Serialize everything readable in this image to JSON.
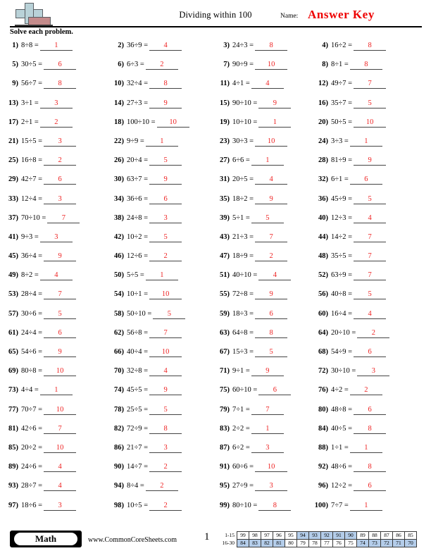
{
  "header": {
    "title": "Dividing within 100",
    "name_label": "Name:",
    "answer_key": "Answer Key",
    "instructions": "Solve each problem.",
    "logo_name": "commoncoresheets-logo"
  },
  "problems": [
    {
      "num": "1)",
      "expr": "8÷8 =",
      "answer": "1"
    },
    {
      "num": "2)",
      "expr": "36÷9 =",
      "answer": "4"
    },
    {
      "num": "3)",
      "expr": "24÷3 =",
      "answer": "8"
    },
    {
      "num": "4)",
      "expr": "16÷2 =",
      "answer": "8"
    },
    {
      "num": "5)",
      "expr": "30÷5 =",
      "answer": "6"
    },
    {
      "num": "6)",
      "expr": "6÷3 =",
      "answer": "2"
    },
    {
      "num": "7)",
      "expr": "90÷9 =",
      "answer": "10"
    },
    {
      "num": "8)",
      "expr": "8÷1 =",
      "answer": "8"
    },
    {
      "num": "9)",
      "expr": "56÷7 =",
      "answer": "8"
    },
    {
      "num": "10)",
      "expr": "32÷4 =",
      "answer": "8"
    },
    {
      "num": "11)",
      "expr": "4÷1 =",
      "answer": "4"
    },
    {
      "num": "12)",
      "expr": "49÷7 =",
      "answer": "7"
    },
    {
      "num": "13)",
      "expr": "3÷1 =",
      "answer": "3"
    },
    {
      "num": "14)",
      "expr": "27÷3 =",
      "answer": "9"
    },
    {
      "num": "15)",
      "expr": "90÷10 =",
      "answer": "9"
    },
    {
      "num": "16)",
      "expr": "35÷7 =",
      "answer": "5"
    },
    {
      "num": "17)",
      "expr": "2÷1 =",
      "answer": "2"
    },
    {
      "num": "18)",
      "expr": "100÷10 =",
      "answer": "10"
    },
    {
      "num": "19)",
      "expr": "10÷10 =",
      "answer": "1"
    },
    {
      "num": "20)",
      "expr": "50÷5 =",
      "answer": "10"
    },
    {
      "num": "21)",
      "expr": "15÷5 =",
      "answer": "3"
    },
    {
      "num": "22)",
      "expr": "9÷9 =",
      "answer": "1"
    },
    {
      "num": "23)",
      "expr": "30÷3 =",
      "answer": "10"
    },
    {
      "num": "24)",
      "expr": "3÷3 =",
      "answer": "1"
    },
    {
      "num": "25)",
      "expr": "16÷8 =",
      "answer": "2"
    },
    {
      "num": "26)",
      "expr": "20÷4 =",
      "answer": "5"
    },
    {
      "num": "27)",
      "expr": "6÷6 =",
      "answer": "1"
    },
    {
      "num": "28)",
      "expr": "81÷9 =",
      "answer": "9"
    },
    {
      "num": "29)",
      "expr": "42÷7 =",
      "answer": "6"
    },
    {
      "num": "30)",
      "expr": "63÷7 =",
      "answer": "9"
    },
    {
      "num": "31)",
      "expr": "20÷5 =",
      "answer": "4"
    },
    {
      "num": "32)",
      "expr": "6÷1 =",
      "answer": "6"
    },
    {
      "num": "33)",
      "expr": "12÷4 =",
      "answer": "3"
    },
    {
      "num": "34)",
      "expr": "36÷6 =",
      "answer": "6"
    },
    {
      "num": "35)",
      "expr": "18÷2 =",
      "answer": "9"
    },
    {
      "num": "36)",
      "expr": "45÷9 =",
      "answer": "5"
    },
    {
      "num": "37)",
      "expr": "70÷10 =",
      "answer": "7"
    },
    {
      "num": "38)",
      "expr": "24÷8 =",
      "answer": "3"
    },
    {
      "num": "39)",
      "expr": "5÷1 =",
      "answer": "5"
    },
    {
      "num": "40)",
      "expr": "12÷3 =",
      "answer": "4"
    },
    {
      "num": "41)",
      "expr": "9÷3 =",
      "answer": "3"
    },
    {
      "num": "42)",
      "expr": "10÷2 =",
      "answer": "5"
    },
    {
      "num": "43)",
      "expr": "21÷3 =",
      "answer": "7"
    },
    {
      "num": "44)",
      "expr": "14÷2 =",
      "answer": "7"
    },
    {
      "num": "45)",
      "expr": "36÷4 =",
      "answer": "9"
    },
    {
      "num": "46)",
      "expr": "12÷6 =",
      "answer": "2"
    },
    {
      "num": "47)",
      "expr": "18÷9 =",
      "answer": "2"
    },
    {
      "num": "48)",
      "expr": "35÷5 =",
      "answer": "7"
    },
    {
      "num": "49)",
      "expr": "8÷2 =",
      "answer": "4"
    },
    {
      "num": "50)",
      "expr": "5÷5 =",
      "answer": "1"
    },
    {
      "num": "51)",
      "expr": "40÷10 =",
      "answer": "4"
    },
    {
      "num": "52)",
      "expr": "63÷9 =",
      "answer": "7"
    },
    {
      "num": "53)",
      "expr": "28÷4 =",
      "answer": "7"
    },
    {
      "num": "54)",
      "expr": "10÷1 =",
      "answer": "10"
    },
    {
      "num": "55)",
      "expr": "72÷8 =",
      "answer": "9"
    },
    {
      "num": "56)",
      "expr": "40÷8 =",
      "answer": "5"
    },
    {
      "num": "57)",
      "expr": "30÷6 =",
      "answer": "5"
    },
    {
      "num": "58)",
      "expr": "50÷10 =",
      "answer": "5"
    },
    {
      "num": "59)",
      "expr": "18÷3 =",
      "answer": "6"
    },
    {
      "num": "60)",
      "expr": "16÷4 =",
      "answer": "4"
    },
    {
      "num": "61)",
      "expr": "24÷4 =",
      "answer": "6"
    },
    {
      "num": "62)",
      "expr": "56÷8 =",
      "answer": "7"
    },
    {
      "num": "63)",
      "expr": "64÷8 =",
      "answer": "8"
    },
    {
      "num": "64)",
      "expr": "20÷10 =",
      "answer": "2"
    },
    {
      "num": "65)",
      "expr": "54÷6 =",
      "answer": "9"
    },
    {
      "num": "66)",
      "expr": "40÷4 =",
      "answer": "10"
    },
    {
      "num": "67)",
      "expr": "15÷3 =",
      "answer": "5"
    },
    {
      "num": "68)",
      "expr": "54÷9 =",
      "answer": "6"
    },
    {
      "num": "69)",
      "expr": "80÷8 =",
      "answer": "10"
    },
    {
      "num": "70)",
      "expr": "32÷8 =",
      "answer": "4"
    },
    {
      "num": "71)",
      "expr": "9÷1 =",
      "answer": "9"
    },
    {
      "num": "72)",
      "expr": "30÷10 =",
      "answer": "3"
    },
    {
      "num": "73)",
      "expr": "4÷4 =",
      "answer": "1"
    },
    {
      "num": "74)",
      "expr": "45÷5 =",
      "answer": "9"
    },
    {
      "num": "75)",
      "expr": "60÷10 =",
      "answer": "6"
    },
    {
      "num": "76)",
      "expr": "4÷2 =",
      "answer": "2"
    },
    {
      "num": "77)",
      "expr": "70÷7 =",
      "answer": "10"
    },
    {
      "num": "78)",
      "expr": "25÷5 =",
      "answer": "5"
    },
    {
      "num": "79)",
      "expr": "7÷1 =",
      "answer": "7"
    },
    {
      "num": "80)",
      "expr": "48÷8 =",
      "answer": "6"
    },
    {
      "num": "81)",
      "expr": "42÷6 =",
      "answer": "7"
    },
    {
      "num": "82)",
      "expr": "72÷9 =",
      "answer": "8"
    },
    {
      "num": "83)",
      "expr": "2÷2 =",
      "answer": "1"
    },
    {
      "num": "84)",
      "expr": "40÷5 =",
      "answer": "8"
    },
    {
      "num": "85)",
      "expr": "20÷2 =",
      "answer": "10"
    },
    {
      "num": "86)",
      "expr": "21÷7 =",
      "answer": "3"
    },
    {
      "num": "87)",
      "expr": "6÷2 =",
      "answer": "3"
    },
    {
      "num": "88)",
      "expr": "1÷1 =",
      "answer": "1"
    },
    {
      "num": "89)",
      "expr": "24÷6 =",
      "answer": "4"
    },
    {
      "num": "90)",
      "expr": "14÷7 =",
      "answer": "2"
    },
    {
      "num": "91)",
      "expr": "60÷6 =",
      "answer": "10"
    },
    {
      "num": "92)",
      "expr": "48÷6 =",
      "answer": "8"
    },
    {
      "num": "93)",
      "expr": "28÷7 =",
      "answer": "4"
    },
    {
      "num": "94)",
      "expr": "8÷4 =",
      "answer": "2"
    },
    {
      "num": "95)",
      "expr": "27÷9 =",
      "answer": "3"
    },
    {
      "num": "96)",
      "expr": "12÷2 =",
      "answer": "6"
    },
    {
      "num": "97)",
      "expr": "18÷6 =",
      "answer": "3"
    },
    {
      "num": "98)",
      "expr": "10÷5 =",
      "answer": "2"
    },
    {
      "num": "99)",
      "expr": "80÷10 =",
      "answer": "8"
    },
    {
      "num": "100)",
      "expr": "7÷7 =",
      "answer": "1"
    }
  ],
  "footer": {
    "subject_badge": "Math",
    "site_url": "www.CommonCoreSheets.com",
    "page_number": "1",
    "highlight_color": "#b4cdea"
  },
  "score_table": {
    "rows": [
      {
        "label": "1-15",
        "cells": [
          {
            "v": "99",
            "hl": false
          },
          {
            "v": "98",
            "hl": false
          },
          {
            "v": "97",
            "hl": false
          },
          {
            "v": "96",
            "hl": false
          },
          {
            "v": "95",
            "hl": false
          },
          {
            "v": "94",
            "hl": true
          },
          {
            "v": "93",
            "hl": true
          },
          {
            "v": "92",
            "hl": true
          },
          {
            "v": "91",
            "hl": true
          },
          {
            "v": "90",
            "hl": true
          },
          {
            "v": "89",
            "hl": false
          },
          {
            "v": "88",
            "hl": false
          },
          {
            "v": "87",
            "hl": false
          },
          {
            "v": "86",
            "hl": false
          },
          {
            "v": "85",
            "hl": false
          }
        ]
      },
      {
        "label": "16-30",
        "cells": [
          {
            "v": "84",
            "hl": true
          },
          {
            "v": "83",
            "hl": true
          },
          {
            "v": "82",
            "hl": true
          },
          {
            "v": "81",
            "hl": true
          },
          {
            "v": "80",
            "hl": false
          },
          {
            "v": "79",
            "hl": false
          },
          {
            "v": "78",
            "hl": false
          },
          {
            "v": "77",
            "hl": false
          },
          {
            "v": "76",
            "hl": false
          },
          {
            "v": "75",
            "hl": false
          },
          {
            "v": "74",
            "hl": true
          },
          {
            "v": "73",
            "hl": true
          },
          {
            "v": "72",
            "hl": true
          },
          {
            "v": "71",
            "hl": true
          },
          {
            "v": "70",
            "hl": true
          }
        ]
      }
    ]
  }
}
